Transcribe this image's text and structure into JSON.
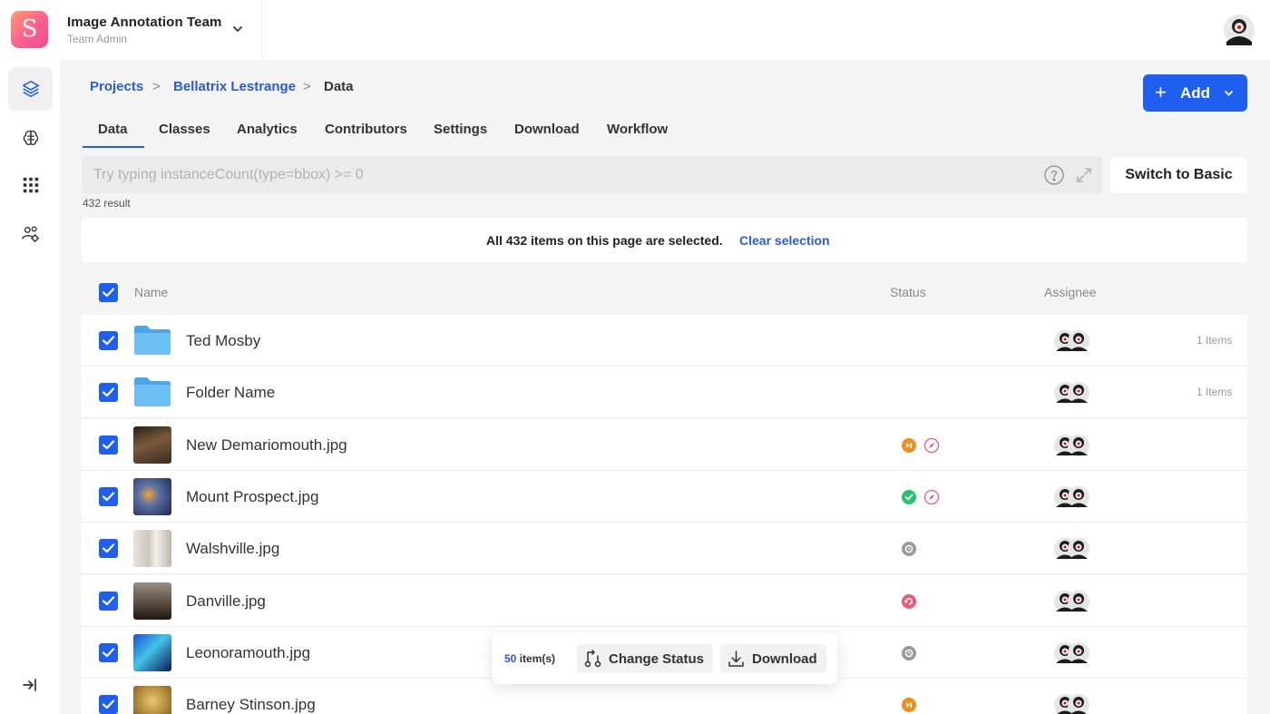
{
  "header": {
    "logo_letter": "S",
    "team_name": "Image Annotation Team",
    "team_role": "Team Admin"
  },
  "rail": {
    "items": [
      {
        "icon": "layers-icon",
        "active": true
      },
      {
        "icon": "brain-icon",
        "active": false
      },
      {
        "icon": "grid-dots-icon",
        "active": false
      },
      {
        "icon": "users-settings-icon",
        "active": false
      }
    ],
    "collapse_icon": "collapse-sidebar-icon"
  },
  "breadcrumb": {
    "projects": "Projects",
    "project": "Bellatrix Lestrange",
    "current": "Data",
    "separator": ">"
  },
  "add_button": {
    "plus": "+",
    "label": "Add"
  },
  "tabs": [
    "Data",
    "Classes",
    "Analytics",
    "Contributors",
    "Settings",
    "Download",
    "Workflow"
  ],
  "active_tab": "Data",
  "query": {
    "placeholder": "Try typing instanceCount(type=bbox) >= 0",
    "switch_label": "Switch to Basic",
    "result_count": "432 result"
  },
  "banner": {
    "text": "All 432 items on this page are selected.",
    "link": "Clear selection"
  },
  "table": {
    "columns": {
      "name": "Name",
      "status": "Status",
      "assignee": "Assignee"
    },
    "rows": [
      {
        "type": "folder",
        "name": "Ted Mosby",
        "items": "1 Items",
        "statuses": []
      },
      {
        "type": "folder",
        "name": "Folder Name",
        "items": "1 Items",
        "statuses": []
      },
      {
        "type": "image",
        "name": "New Demariomouth.jpg",
        "items": "",
        "statuses": [
          "in-progress",
          "quality-check"
        ]
      },
      {
        "type": "image",
        "name": "Mount Prospect.jpg",
        "items": "",
        "statuses": [
          "completed",
          "quality-check"
        ]
      },
      {
        "type": "image",
        "name": "Walshville.jpg",
        "items": "",
        "statuses": [
          "not-started"
        ]
      },
      {
        "type": "image",
        "name": "Danville.jpg",
        "items": "",
        "statuses": [
          "returned"
        ]
      },
      {
        "type": "image",
        "name": "Leonoramouth.jpg",
        "items": "",
        "statuses": [
          "not-started"
        ]
      },
      {
        "type": "image",
        "name": "Barney Stinson.jpg",
        "items": "",
        "statuses": [
          "in-progress"
        ]
      }
    ]
  },
  "status_colors": {
    "in-progress": "#f28c1b",
    "quality-check": "#ef5a72",
    "completed": "#27c26c",
    "not-started": "#9a9a9a",
    "returned": "#ef5a72"
  },
  "floatbar": {
    "count": "50",
    "count_suffix": "item(s)",
    "change_status": "Change Status",
    "download": "Download"
  }
}
